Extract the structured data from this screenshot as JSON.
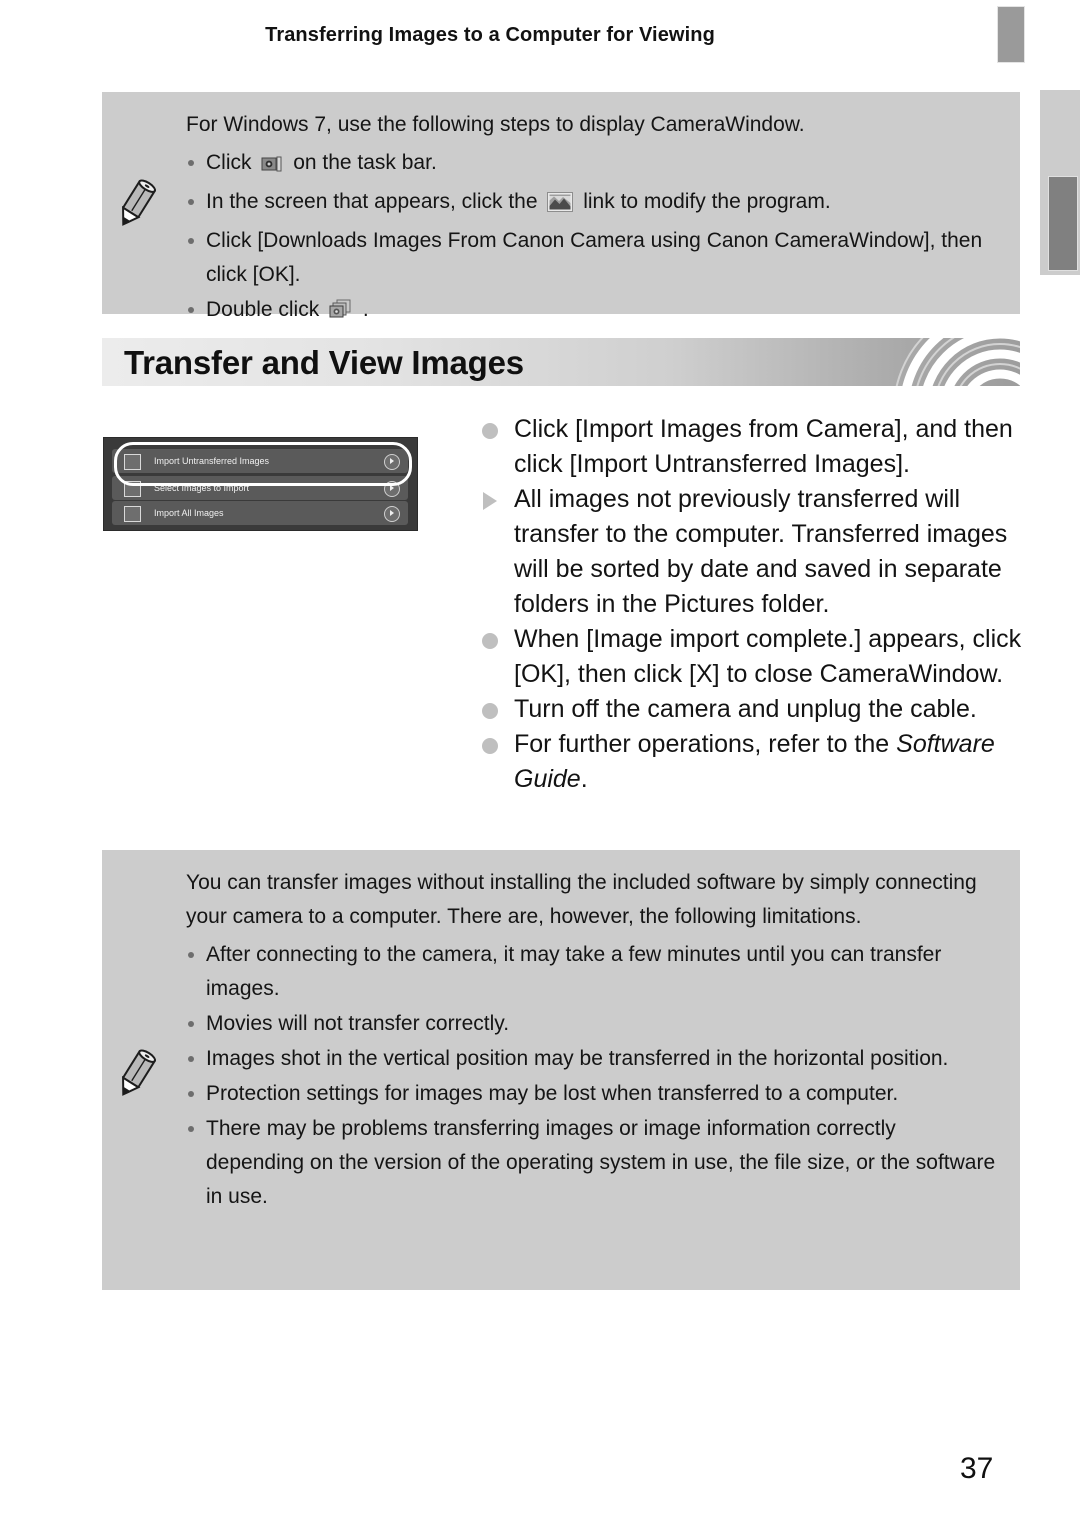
{
  "header": {
    "title": "Transferring Images to a Computer for Viewing",
    "tab_icon": "header-tab-marker",
    "side_tab_icon": "side-tab-marker"
  },
  "note_top": {
    "icon": "pencil-note-icon",
    "lead": "For Windows 7, use the following steps to display CameraWindow.",
    "items": [
      {
        "pre": "Click",
        "icon": "taskbar-camera-icon",
        "post": "on the task bar."
      },
      {
        "pre": "In the screen that appears, click the",
        "icon": "picture-thumbnail-icon",
        "post": "link to modify the program."
      },
      {
        "pre": "Click [Downloads Images From Canon Camera using Canon CameraWindow], then click [OK].",
        "icon": "",
        "post": ""
      },
      {
        "pre": "Double click",
        "icon": "camerawindow-app-icon",
        "post": "."
      }
    ]
  },
  "section": {
    "title": "Transfer and View Images",
    "decoration": "concentric-rings"
  },
  "screenshot": {
    "name": "camerawindow-import-menu",
    "rows": [
      {
        "label": "Import Untransferred Images",
        "icon": "import-untransferred-icon",
        "highlighted": true
      },
      {
        "label": "Select Images to Import",
        "icon": "select-images-icon",
        "highlighted": false
      },
      {
        "label": "Import All Images",
        "icon": "import-all-icon",
        "highlighted": false
      }
    ],
    "callout": "white-oval-highlight"
  },
  "steps": [
    {
      "bullet": "circle",
      "text": "Click [Import Images from Camera], and then click [Import Untransferred Images]."
    },
    {
      "bullet": "triangle",
      "text": "All images not previously transferred will transfer to the computer. Transferred images will be sorted by date and saved in separate folders in the Pictures folder."
    },
    {
      "bullet": "circle",
      "text": "When [Image import complete.] appears, click [OK], then click [X] to close CameraWindow."
    },
    {
      "bullet": "circle",
      "text": "Turn off the camera and unplug the cable."
    },
    {
      "bullet": "circle",
      "text": "For further operations, refer to the ",
      "italic_tail": "Software Guide",
      "tail": "."
    }
  ],
  "note_bottom": {
    "icon": "pencil-note-icon",
    "lead": "You can transfer images without installing the included software by simply connecting your camera to a computer. There are, however, the following limitations.",
    "items": [
      "After connecting to the camera, it may take a few minutes until you can transfer images.",
      "Movies will not transfer correctly.",
      "Images shot in the vertical position may be transferred in the horizontal position.",
      "Protection settings for images may be lost when transferred to a computer.",
      "There may be problems transferring images or image information correctly depending on the version of the operating system in use, the file size, or the software in use."
    ]
  },
  "page_number": "37",
  "colors": {
    "note_panel": "#cccccc",
    "bullet_gray": "#bfbfbf",
    "tab_dark": "#808080",
    "tab_light": "#cccccc",
    "screenshot_bg": "#3a3a3a"
  }
}
